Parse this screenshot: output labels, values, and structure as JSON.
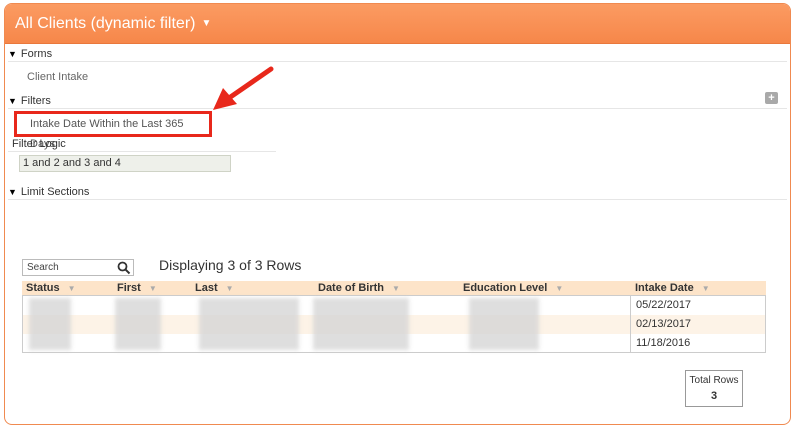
{
  "header": {
    "title": "All Clients (dynamic filter)"
  },
  "forms": {
    "label": "Forms",
    "item": "Client Intake"
  },
  "filters": {
    "label": "Filters",
    "item": "Intake Date Within the Last 365 Days",
    "add_label": "+"
  },
  "filter_logic": {
    "label": "Filter Logic",
    "value": "1 and 2 and 3 and 4"
  },
  "limit_sections": {
    "label": "Limit Sections"
  },
  "search": {
    "placeholder": "Search"
  },
  "display_count": "Displaying 3 of 3 Rows",
  "table": {
    "columns": [
      "Status",
      "First",
      "Last",
      "Date of Birth",
      "Education Level",
      "Intake Date"
    ],
    "intake_dates": [
      "05/22/2017",
      "02/13/2017",
      "11/18/2016"
    ]
  },
  "totals": {
    "label": "Total Rows",
    "value": "3"
  },
  "colors": {
    "header": "#f6874a",
    "highlight": "#e8281b",
    "row_alt": "#fdf3e7"
  }
}
